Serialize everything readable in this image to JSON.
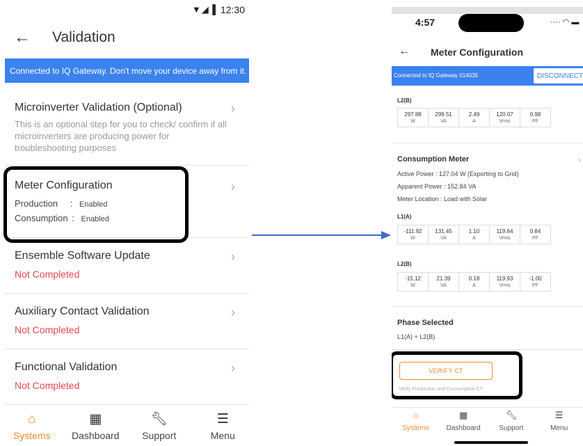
{
  "left": {
    "status": {
      "time": "12:30"
    },
    "header": {
      "title": "Validation"
    },
    "banner": "Connected to IQ Gateway. Don't move your device away from it.",
    "sections": [
      {
        "title": "Microinverter Validation (Optional)",
        "desc": "This is an optional step for you to check/ confirm if all microinverters are producing power for troubleshooting purposes"
      },
      {
        "title": "Meter Configuration",
        "rows": [
          {
            "label": "Production",
            "sep": ":",
            "value": "Enabled"
          },
          {
            "label": "Consumption",
            "sep": ":",
            "value": "Enabled"
          }
        ]
      },
      {
        "title": "Ensemble Software Update",
        "status": "Not Completed"
      },
      {
        "title": "Auxiliary Contact Validation",
        "status": "Not Completed"
      },
      {
        "title": "Functional Validation",
        "status": "Not Completed"
      }
    ],
    "nav": [
      {
        "label": "Systems",
        "icon": "home-icon"
      },
      {
        "label": "Dashboard",
        "icon": "dashboard-icon"
      },
      {
        "label": "Support",
        "icon": "wrench-icon"
      },
      {
        "label": "Menu",
        "icon": "menu-icon"
      }
    ]
  },
  "right": {
    "status": {
      "time": "4:57"
    },
    "header": {
      "title": "Meter Configuration"
    },
    "banner": {
      "text": "Connected to IQ Gateway 014035",
      "button": "DISCONNECT"
    },
    "production_l2": {
      "label": "L2(B)",
      "cells": [
        {
          "value": "297.88",
          "unit": "W"
        },
        {
          "value": "299.51",
          "unit": "VA"
        },
        {
          "value": "2.49",
          "unit": "A"
        },
        {
          "value": "120.07",
          "unit": "Vrms"
        },
        {
          "value": "0.98",
          "unit": "PF"
        }
      ]
    },
    "consumption": {
      "title": "Consumption Meter",
      "active_power": "Active Power : 127.04 W (Exporting to Grid)",
      "apparent_power": "Apparent Power : 152.84 VA",
      "location": "Meter Location : Load with Solar",
      "l1": {
        "label": "L1(A)",
        "cells": [
          {
            "value": "-111.92",
            "unit": "W"
          },
          {
            "value": "131.45",
            "unit": "VA"
          },
          {
            "value": "1.10",
            "unit": "A"
          },
          {
            "value": "119.64",
            "unit": "Vrms"
          },
          {
            "value": "0.84",
            "unit": "PF"
          }
        ]
      },
      "l2": {
        "label": "L2(B)",
        "cells": [
          {
            "value": "-15.12",
            "unit": "W"
          },
          {
            "value": "21.39",
            "unit": "VA"
          },
          {
            "value": "0.18",
            "unit": "A"
          },
          {
            "value": "119.93",
            "unit": "Vrms"
          },
          {
            "value": "-1.00",
            "unit": "PF"
          }
        ]
      }
    },
    "phase": {
      "title": "Phase Selected",
      "value": "L1(A) + L2(B)"
    },
    "verify": {
      "button": "VERIFY CT",
      "desc": "Verify Production and Consumption CT"
    },
    "nav": [
      {
        "label": "Systems",
        "icon": "home-icon"
      },
      {
        "label": "Dashboard",
        "icon": "dashboard-icon"
      },
      {
        "label": "Support",
        "icon": "wrench-icon"
      },
      {
        "label": "Menu",
        "icon": "menu-icon"
      }
    ]
  },
  "colors": {
    "accent": "#f2892c",
    "banner": "#3b82ee",
    "error": "#e2474d",
    "highlight_border": "#000000"
  }
}
